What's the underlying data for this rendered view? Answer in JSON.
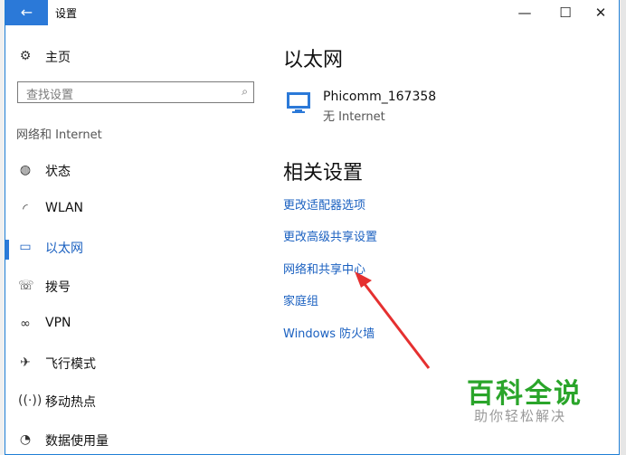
{
  "window": {
    "title": "设置",
    "back_icon": "←",
    "minimize_icon": "—",
    "maximize_icon": "☐",
    "close_icon": "✕"
  },
  "sidebar": {
    "home": {
      "label": "主页",
      "icon": "gear-icon"
    },
    "search": {
      "placeholder": "查找设置"
    },
    "section": "网络和 Internet",
    "items": [
      {
        "label": "状态",
        "icon": "globe-icon"
      },
      {
        "label": "WLAN",
        "icon": "wifi-icon"
      },
      {
        "label": "以太网",
        "icon": "monitor-icon"
      },
      {
        "label": "拨号",
        "icon": "phone-icon"
      },
      {
        "label": "VPN",
        "icon": "vpn-icon"
      },
      {
        "label": "飞行模式",
        "icon": "airplane-icon"
      },
      {
        "label": "移动热点",
        "icon": "hotspot-icon"
      },
      {
        "label": "数据使用量",
        "icon": "data-usage-icon"
      }
    ],
    "active_index": 2
  },
  "main": {
    "heading": "以太网",
    "network": {
      "name": "Phicomm_167358",
      "status": "无 Internet"
    },
    "related_heading": "相关设置",
    "links": [
      "更改适配器选项",
      "更改高级共享设置",
      "网络和共享中心",
      "家庭组",
      "Windows 防火墙"
    ]
  },
  "watermark": {
    "line1": "百科全说",
    "line2": "助你轻松解决"
  },
  "colors": {
    "accent": "#2b79d8",
    "link": "#1a60c0",
    "watermark": "#2aa52a",
    "arrow": "#e53030"
  }
}
